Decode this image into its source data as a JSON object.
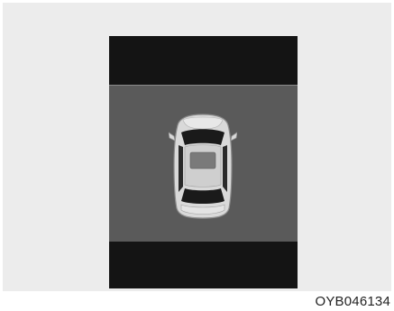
{
  "figure": {
    "code": "OYB046134"
  },
  "colors": {
    "page_background": "#ececec",
    "screen_dark": "#141414",
    "screen_zone": "#5a5a5a",
    "car_body": "#d9d9d9",
    "car_glass": "#1a1a1a",
    "car_sunroof": "#7a7a7a"
  },
  "icons": {
    "vehicle": "car-top-view-icon"
  }
}
